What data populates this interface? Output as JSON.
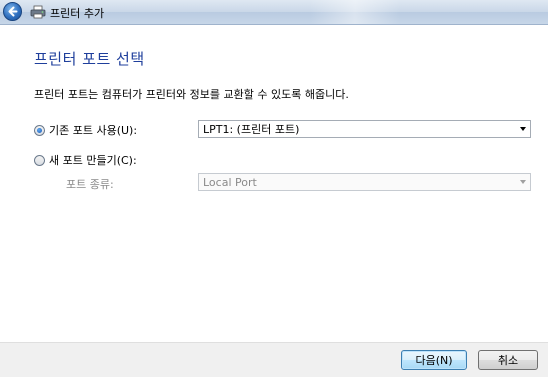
{
  "window": {
    "title": "프린터 추가",
    "accent_color": "#1f3f9c"
  },
  "icons": {
    "back": "back-arrow-icon",
    "printer": "printer-icon"
  },
  "main": {
    "heading": "프린터 포트 선택",
    "description": "프린터 포트는 컴퓨터가 프린터와 정보를 교환할 수 있도록 해줍니다.",
    "use_existing_label": "기존 포트 사용(U):",
    "use_existing_selected": true,
    "existing_port_value": "LPT1: (프린터 포트)",
    "create_new_label": "새 포트 만들기(C):",
    "create_new_selected": false,
    "port_type_label": "포트 종류:",
    "port_type_value": "Local Port"
  },
  "footer": {
    "next_label": "다음(N)",
    "cancel_label": "취소"
  }
}
